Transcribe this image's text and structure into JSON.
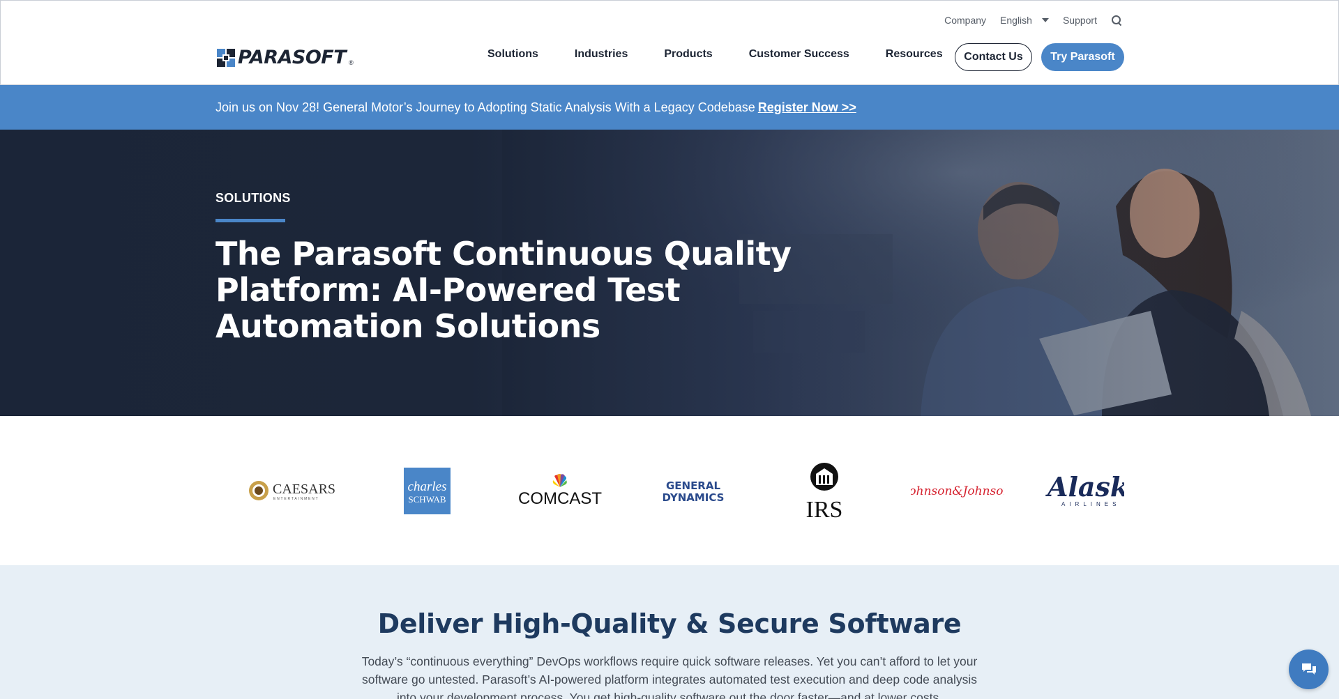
{
  "utility_nav": {
    "company": "Company",
    "language": "English",
    "support": "Support",
    "search_icon": "search-icon"
  },
  "logo": {
    "text": "PARASOFT",
    "reg": "®"
  },
  "main_nav": {
    "items": [
      "Solutions",
      "Industries",
      "Products",
      "Customer Success",
      "Resources"
    ]
  },
  "cta": {
    "contact": "Contact Us",
    "try": "Try Parasoft"
  },
  "announcement": {
    "text": "Join us on Nov 28! General Motor’s Journey to Adopting Static Analysis With a Legacy Codebase",
    "link": "Register Now >>"
  },
  "hero": {
    "eyebrow": "SOLUTIONS",
    "title": "The Parasoft Continuous Quality Platform: AI-Powered Test Automation Solutions"
  },
  "customer_logos": [
    {
      "name": "Caesars Entertainment",
      "text": "CAESARS",
      "subtext": "ENTERTAINMENT"
    },
    {
      "name": "Charles Schwab",
      "text": "charles",
      "subtext": "SCHWAB"
    },
    {
      "name": "Comcast",
      "text": "COMCAST"
    },
    {
      "name": "General Dynamics",
      "text": "GENERAL",
      "subtext": "DYNAMICS"
    },
    {
      "name": "IRS",
      "text": "IRS"
    },
    {
      "name": "Johnson & Johnson",
      "text": "Johnson&Johnson"
    },
    {
      "name": "Alaska Airlines",
      "text": "Alaska",
      "subtext": "AIRLINES"
    }
  ],
  "intro": {
    "title": "Deliver High-Quality & Secure Software",
    "text": "Today’s “continuous everything” DevOps workflows require quick software releases. Yet you can’t afford to let your software go untested. Parasoft’s AI-powered platform integrates automated test execution and deep code analysis into your development process. You get high-quality software out the door faster—and at lower costs."
  },
  "colors": {
    "accent": "#4a86c8",
    "navy": "#1e3a5f",
    "hero_bg": "#1b2538"
  },
  "chat": {
    "icon": "chat-icon"
  }
}
